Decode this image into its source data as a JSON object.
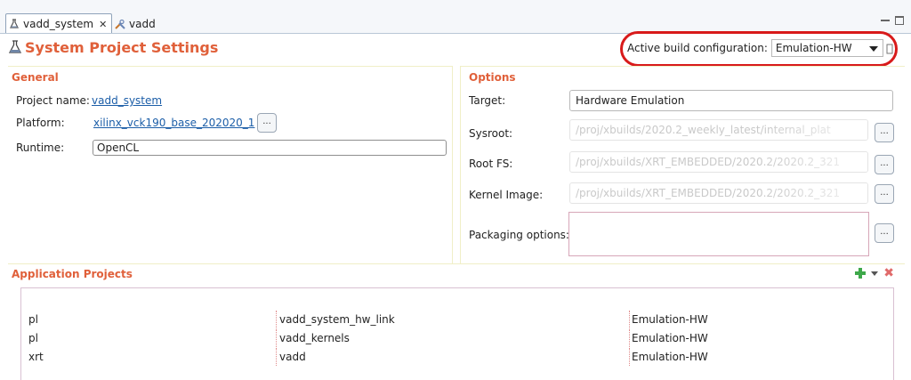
{
  "tabs": [
    {
      "label": "vadd_system",
      "close": "✕",
      "active": true
    },
    {
      "label": "vadd",
      "active": false
    }
  ],
  "header": {
    "title": "System Project Settings",
    "build_config_label": "Active build configuration:",
    "build_config_value": "Emulation-HW"
  },
  "general": {
    "title": "General",
    "project_name_label": "Project name:",
    "project_name_value": "vadd_system",
    "platform_label": "Platform:",
    "platform_value": "xilinx_vck190_base_202020_1",
    "runtime_label": "Runtime:",
    "runtime_value": "OpenCL",
    "browse_label": "..."
  },
  "options": {
    "title": "Options",
    "target_label": "Target:",
    "target_value": "Hardware Emulation",
    "sysroot_label": "Sysroot:",
    "sysroot_value": "/proj/xbuilds/2020.2_weekly_latest/internal_plat",
    "rootfs_label": "Root FS:",
    "rootfs_value": "/proj/xbuilds/XRT_EMBEDDED/2020.2/2020.2_321",
    "kernel_label": "Kernel Image:",
    "kernel_value": "/proj/xbuilds/XRT_EMBEDDED/2020.2/2020.2_321",
    "packaging_label": "Packaging options:",
    "packaging_value": "",
    "browse_label": "..."
  },
  "app_projects": {
    "title": "Application Projects",
    "rows": [
      {
        "type": "pl",
        "name": "vadd_system_hw_link",
        "config": "Emulation-HW"
      },
      {
        "type": "pl",
        "name": "vadd_kernels",
        "config": "Emulation-HW"
      },
      {
        "type": "xrt",
        "name": "vadd",
        "config": "Emulation-HW"
      }
    ]
  },
  "colors": {
    "accent": "#e0603a",
    "link": "#1c5ea8",
    "highlight": "#d81a1a"
  }
}
